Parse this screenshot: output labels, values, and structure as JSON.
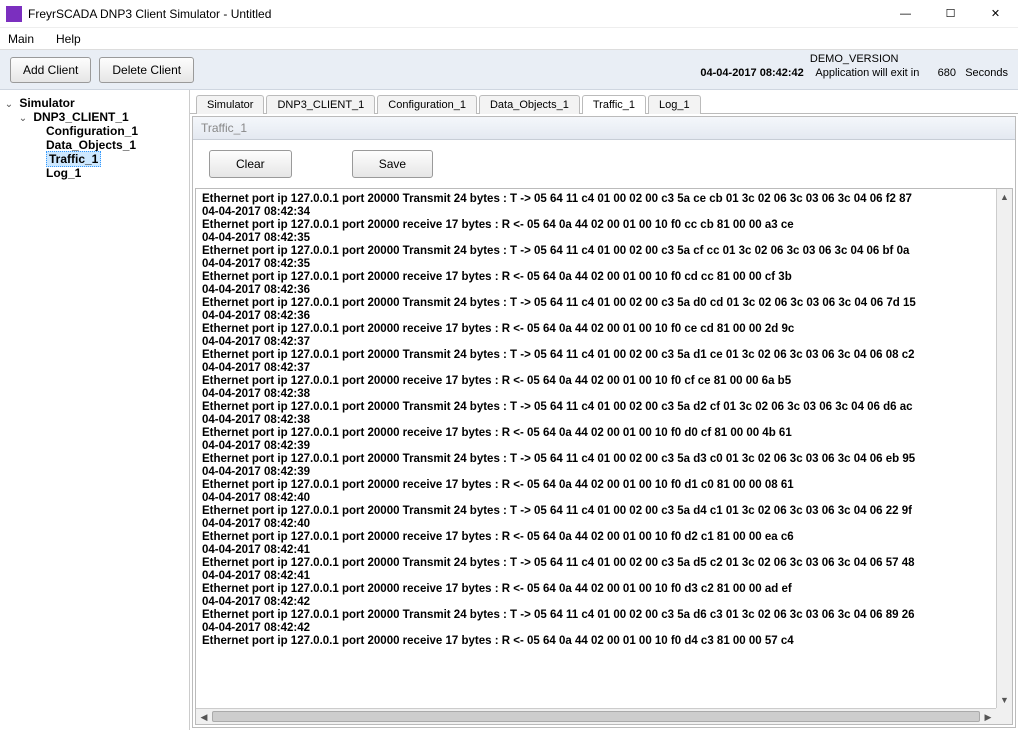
{
  "window": {
    "title": "FreyrSCADA DNP3 Client Simulator - Untitled"
  },
  "menu": {
    "main": "Main",
    "help": "Help"
  },
  "toolbar": {
    "add_client": "Add Client",
    "delete_client": "Delete Client"
  },
  "status": {
    "demo": "DEMO_VERSION",
    "datetime": "04-04-2017 08:42:42",
    "exit_prefix": "Application will exit in",
    "exit_seconds": "680",
    "seconds_label": "Seconds"
  },
  "tree": {
    "root": "Simulator",
    "client": "DNP3_CLIENT_1",
    "children": {
      "config": "Configuration_1",
      "data": "Data_Objects_1",
      "traffic": "Traffic_1",
      "log": "Log_1"
    }
  },
  "tabs": {
    "simulator": "Simulator",
    "client": "DNP3_CLIENT_1",
    "config": "Configuration_1",
    "data": "Data_Objects_1",
    "traffic": "Traffic_1",
    "log": "Log_1"
  },
  "pane": {
    "header": "Traffic_1",
    "clear": "Clear",
    "save": "Save"
  },
  "log": [
    " Ethernet port ip 127.0.0.1 port 20000 Transmit 24 bytes :    T ->  05 64 11 c4 01 00 02 00 c3 5a ce cb 01 3c 02 06 3c 03 06 3c 04 06 f2 87",
    "04-04-2017 08:42:34",
    " Ethernet port ip 127.0.0.1 port 20000 receive 17 bytes :  R <- 05 64 0a 44 02 00 01 00 10 f0 cc cb 81 00 00 a3 ce",
    "04-04-2017 08:42:35",
    " Ethernet port ip 127.0.0.1 port 20000 Transmit 24 bytes :    T ->  05 64 11 c4 01 00 02 00 c3 5a cf cc 01 3c 02 06 3c 03 06 3c 04 06 bf 0a",
    "04-04-2017 08:42:35",
    " Ethernet port ip 127.0.0.1 port 20000 receive 17 bytes :  R <- 05 64 0a 44 02 00 01 00 10 f0 cd cc 81 00 00 cf 3b",
    "04-04-2017 08:42:36",
    " Ethernet port ip 127.0.0.1 port 20000 Transmit 24 bytes :    T ->  05 64 11 c4 01 00 02 00 c3 5a d0 cd 01 3c 02 06 3c 03 06 3c 04 06 7d 15",
    "04-04-2017 08:42:36",
    " Ethernet port ip 127.0.0.1 port 20000 receive 17 bytes :  R <- 05 64 0a 44 02 00 01 00 10 f0 ce cd 81 00 00 2d 9c",
    "04-04-2017 08:42:37",
    " Ethernet port ip 127.0.0.1 port 20000 Transmit 24 bytes :    T ->  05 64 11 c4 01 00 02 00 c3 5a d1 ce 01 3c 02 06 3c 03 06 3c 04 06 08 c2",
    "04-04-2017 08:42:37",
    " Ethernet port ip 127.0.0.1 port 20000 receive 17 bytes :  R <- 05 64 0a 44 02 00 01 00 10 f0 cf ce 81 00 00 6a b5",
    "04-04-2017 08:42:38",
    " Ethernet port ip 127.0.0.1 port 20000 Transmit 24 bytes :    T ->  05 64 11 c4 01 00 02 00 c3 5a d2 cf 01 3c 02 06 3c 03 06 3c 04 06 d6 ac",
    "04-04-2017 08:42:38",
    " Ethernet port ip 127.0.0.1 port 20000 receive 17 bytes :  R <- 05 64 0a 44 02 00 01 00 10 f0 d0 cf 81 00 00 4b 61",
    "04-04-2017 08:42:39",
    " Ethernet port ip 127.0.0.1 port 20000 Transmit 24 bytes :    T ->  05 64 11 c4 01 00 02 00 c3 5a d3 c0 01 3c 02 06 3c 03 06 3c 04 06 eb 95",
    "04-04-2017 08:42:39",
    " Ethernet port ip 127.0.0.1 port 20000 receive 17 bytes :  R <- 05 64 0a 44 02 00 01 00 10 f0 d1 c0 81 00 00 08 61",
    "04-04-2017 08:42:40",
    " Ethernet port ip 127.0.0.1 port 20000 Transmit 24 bytes :    T ->  05 64 11 c4 01 00 02 00 c3 5a d4 c1 01 3c 02 06 3c 03 06 3c 04 06 22 9f",
    "04-04-2017 08:42:40",
    " Ethernet port ip 127.0.0.1 port 20000 receive 17 bytes :  R <- 05 64 0a 44 02 00 01 00 10 f0 d2 c1 81 00 00 ea c6",
    "04-04-2017 08:42:41",
    " Ethernet port ip 127.0.0.1 port 20000 Transmit 24 bytes :    T ->  05 64 11 c4 01 00 02 00 c3 5a d5 c2 01 3c 02 06 3c 03 06 3c 04 06 57 48",
    "04-04-2017 08:42:41",
    " Ethernet port ip 127.0.0.1 port 20000 receive 17 bytes :  R <- 05 64 0a 44 02 00 01 00 10 f0 d3 c2 81 00 00 ad ef",
    "04-04-2017 08:42:42",
    " Ethernet port ip 127.0.0.1 port 20000 Transmit 24 bytes :    T ->  05 64 11 c4 01 00 02 00 c3 5a d6 c3 01 3c 02 06 3c 03 06 3c 04 06 89 26",
    "04-04-2017 08:42:42",
    " Ethernet port ip 127.0.0.1 port 20000 receive 17 bytes :  R <- 05 64 0a 44 02 00 01 00 10 f0 d4 c3 81 00 00 57 c4"
  ]
}
